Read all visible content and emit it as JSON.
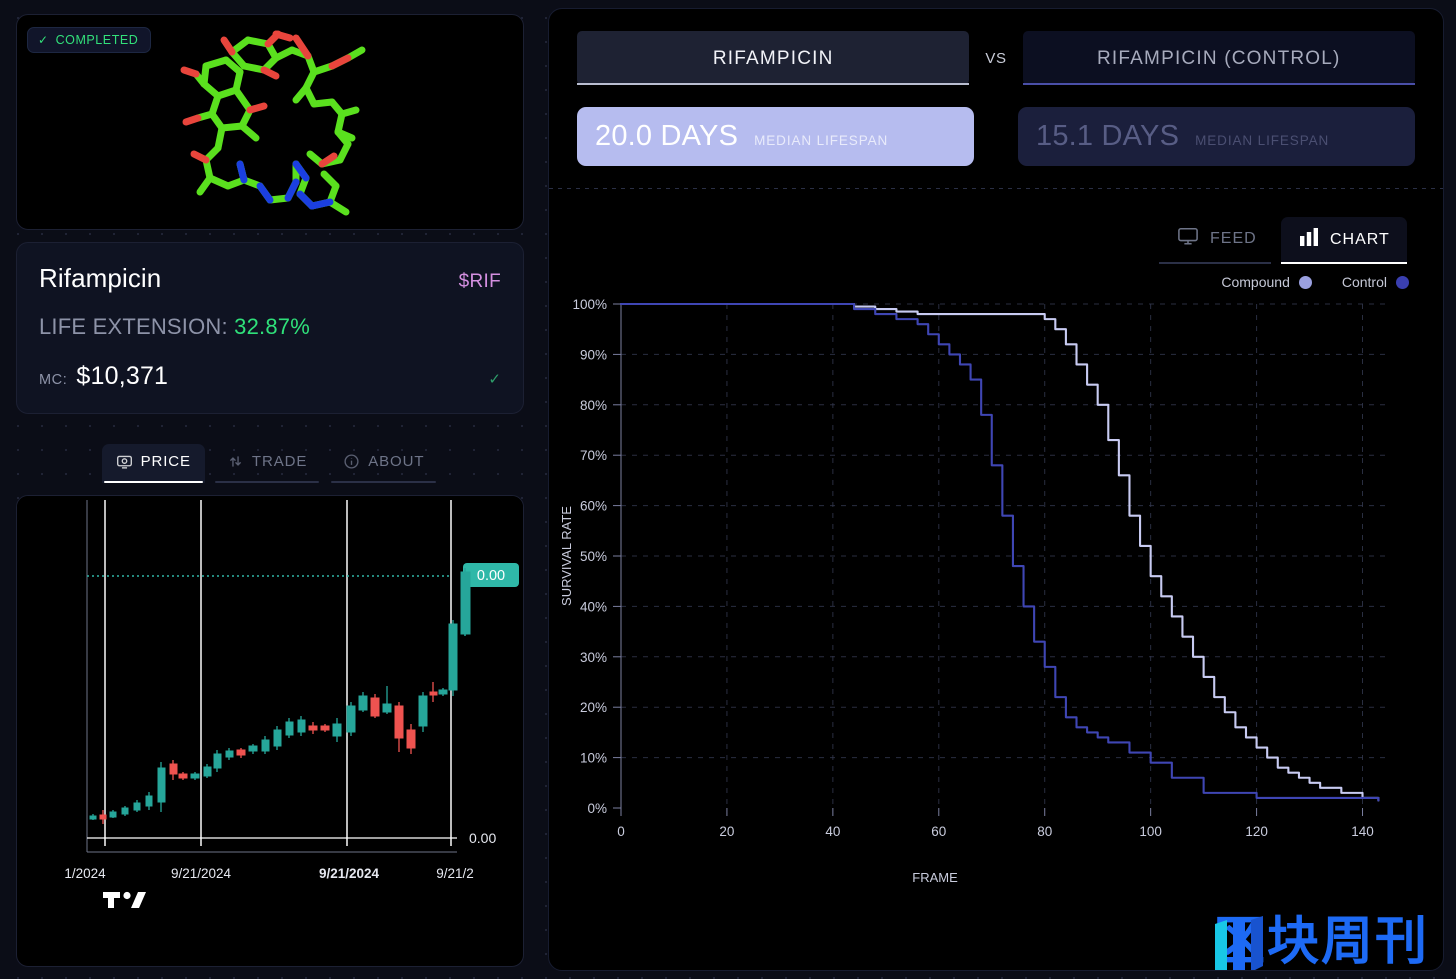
{
  "status_badge": {
    "label": "COMPLETED",
    "icon": "check-icon",
    "color": "#32e07a"
  },
  "molecule": {
    "name": "Rifampicin",
    "render_style": "ball-and-stick"
  },
  "info": {
    "name": "Rifampicin",
    "ticker": "$RIF",
    "life_extension_label": "LIFE EXTENSION:",
    "life_extension_value": "32.87%",
    "mc_label": "MC:",
    "mc_value": "$10,371",
    "verified_icon": "check-icon",
    "accent_green": "#2fe07a",
    "accent_pink": "#d48fe0"
  },
  "tabs": [
    {
      "label": "PRICE",
      "icon": "price-tag-icon",
      "active": true
    },
    {
      "label": "TRADE",
      "icon": "swap-arrow-icon",
      "active": false
    },
    {
      "label": "ABOUT",
      "icon": "info-circle-icon",
      "active": false
    }
  ],
  "price_chart": {
    "last_price_tag": "0.00",
    "axis_price_label": "0.00",
    "x_labels": [
      "1/2024",
      "9/21/2024",
      "9/21/2024",
      "9/21/2"
    ],
    "brand": "TradingView",
    "up_color": "#26a69a",
    "down_color": "#ef5350"
  },
  "comparison": {
    "compound_label": "RIFAMPICIN",
    "vs_label": "VS",
    "control_label": "RIFAMPICIN (CONTROL)"
  },
  "metrics": [
    {
      "value": "20.0 DAYS",
      "label": "MEDIAN LIFESPAN",
      "variant": "primary"
    },
    {
      "value": "15.1 DAYS",
      "label": "MEDIAN LIFESPAN",
      "variant": "secondary"
    }
  ],
  "view_tabs": [
    {
      "label": "FEED",
      "icon": "monitor-icon",
      "active": false
    },
    {
      "label": "CHART",
      "icon": "bar-chart-icon",
      "active": true
    }
  ],
  "legend": [
    {
      "label": "Compound",
      "color": "#9aa0e0"
    },
    {
      "label": "Control",
      "color": "#3a3fb0"
    }
  ],
  "watermark": {
    "text": "区块周刊",
    "color": "#1f6fff"
  },
  "chart_data": {
    "type": "line",
    "title": "",
    "xlabel": "FRAME",
    "ylabel": "SURVIVAL RATE",
    "xlim": [
      0,
      145
    ],
    "ylim": [
      0,
      100
    ],
    "x_ticks": [
      0,
      20,
      40,
      60,
      80,
      100,
      120,
      140
    ],
    "y_ticks": [
      0,
      10,
      20,
      30,
      40,
      50,
      60,
      70,
      80,
      90,
      100
    ],
    "y_tick_labels": [
      "0%",
      "10%",
      "20%",
      "30%",
      "40%",
      "50%",
      "60%",
      "70%",
      "80%",
      "90%",
      "100%"
    ],
    "grid": true,
    "legend_position": "top-right",
    "series": [
      {
        "name": "Compound",
        "color": "#c8cbf2",
        "x": [
          0,
          40,
          44,
          48,
          52,
          56,
          60,
          64,
          68,
          72,
          76,
          80,
          82,
          84,
          86,
          88,
          90,
          92,
          94,
          96,
          98,
          100,
          102,
          104,
          106,
          108,
          110,
          112,
          114,
          116,
          118,
          120,
          122,
          124,
          126,
          128,
          130,
          132,
          136,
          140,
          143
        ],
        "y": [
          100,
          100,
          99.5,
          99,
          98.5,
          98,
          98,
          98,
          98,
          98,
          98,
          97,
          95,
          92,
          88,
          84,
          80,
          73,
          66,
          58,
          52,
          46,
          42,
          38,
          34,
          30,
          26,
          22,
          19,
          16,
          14,
          12,
          10,
          8,
          7,
          6,
          5,
          4,
          3,
          2,
          1.5
        ]
      },
      {
        "name": "Control",
        "color": "#3f46b4",
        "x": [
          0,
          40,
          44,
          48,
          52,
          56,
          58,
          60,
          62,
          64,
          66,
          68,
          70,
          72,
          74,
          76,
          78,
          80,
          82,
          84,
          86,
          88,
          90,
          92,
          96,
          100,
          104,
          110,
          120,
          130,
          143
        ],
        "y": [
          100,
          100,
          99,
          98,
          97,
          96,
          94,
          92,
          90,
          88,
          85,
          78,
          68,
          58,
          48,
          40,
          33,
          28,
          22,
          18,
          16,
          15,
          14,
          13,
          11,
          9,
          6,
          3,
          2,
          2,
          1.5
        ]
      }
    ]
  }
}
